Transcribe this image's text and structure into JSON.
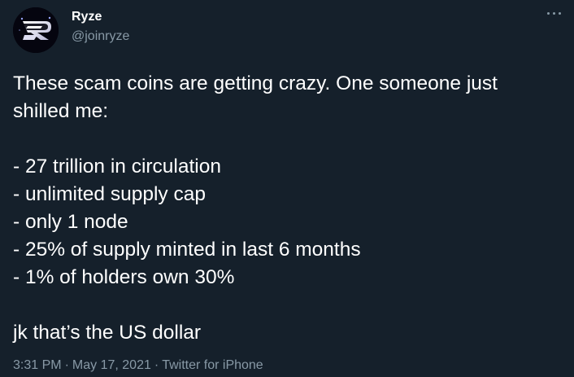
{
  "author": {
    "display_name": "Ryze",
    "handle": "@joinryze",
    "avatar_icon": "ryze-logo-icon"
  },
  "more_icon": "more-options-icon",
  "tweet": {
    "intro_lines": [
      "These scam coins are getting crazy. One someone just",
      "shilled me:"
    ],
    "list_items": [
      "- 27 trillion in circulation",
      "- unlimited supply cap",
      "- only 1 node",
      "- 25% of supply minted in last 6 months",
      "- 1% of holders own 30%"
    ],
    "punchline": "jk that’s the US dollar"
  },
  "meta": {
    "time": "3:31 PM",
    "date": "May 17, 2021",
    "source": "Twitter for iPhone",
    "separator": "·"
  },
  "colors": {
    "background": "#15202b",
    "text": "#ffffff",
    "secondary": "#8899a6"
  }
}
